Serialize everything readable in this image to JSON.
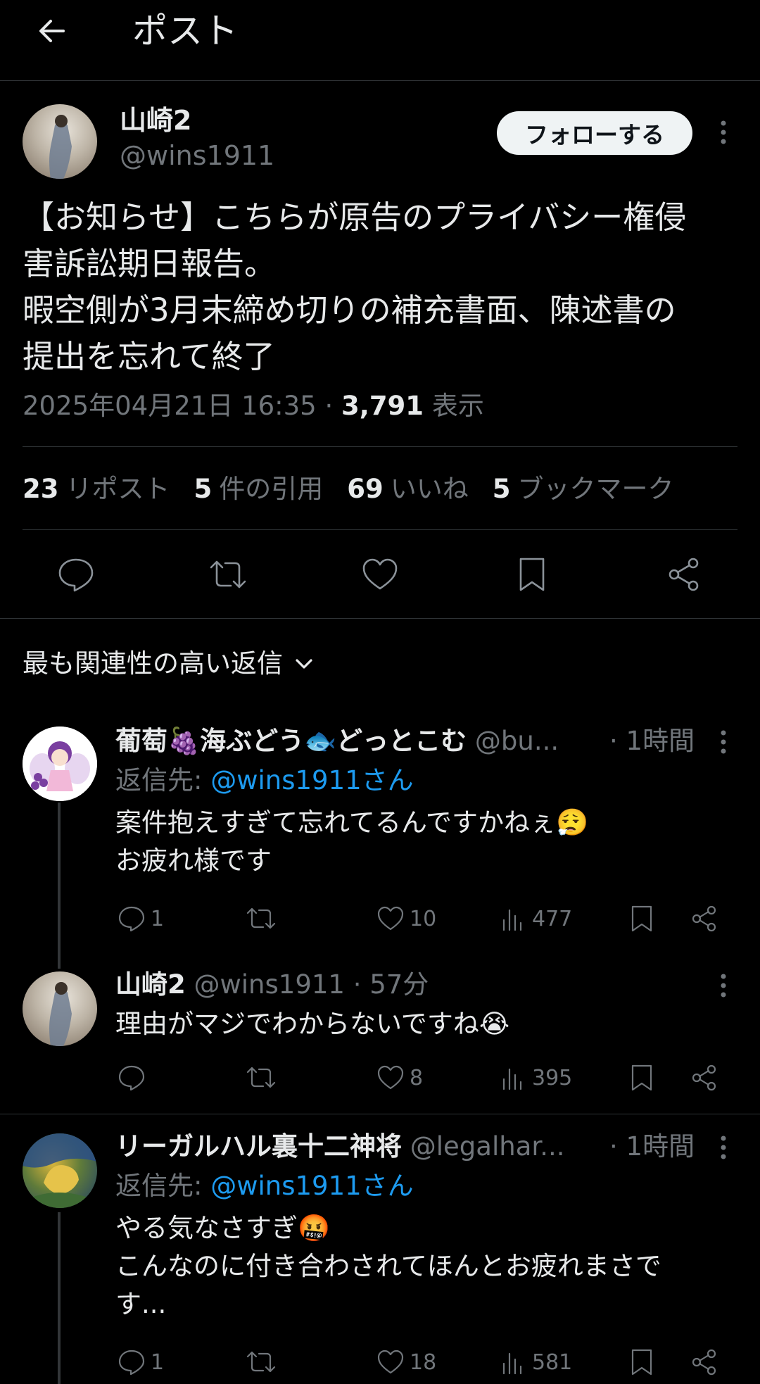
{
  "header": {
    "title": "ポスト"
  },
  "post": {
    "name": "山崎2",
    "handle": "@wins1911",
    "follow_label": "フォローする",
    "text": "【お知らせ】こちらが原告のプライバシー権侵\n害訴訟期日報告。\n暇空側が3月末締め切りの補充書面、陳述書の\n提出を忘れて終了",
    "timestamp": "2025年04月21日 16:35",
    "separator": "·",
    "views_count": "3,791",
    "views_label": "表示",
    "stats": [
      {
        "count": "23",
        "label": "リポスト"
      },
      {
        "count": "5",
        "label": "件の引用"
      },
      {
        "count": "69",
        "label": "いいね"
      },
      {
        "count": "5",
        "label": "ブックマーク"
      }
    ]
  },
  "sort": {
    "label": "最も関連性の高い返信"
  },
  "replies": [
    {
      "name": "葡萄🍇海ぶどう🐟どっとこむ",
      "handle": "@bu...",
      "time": "· 1時間",
      "reply_prefix": "返信先: ",
      "reply_to": "@wins1911さん",
      "text": "案件抱えすぎて忘れてるんですかねぇ😮‍💨\nお疲れ様です",
      "comments": "1",
      "likes": "10",
      "views": "477"
    },
    {
      "name": "山崎2",
      "handle": "@wins1911 · 57分",
      "text": "理由がマジでわからないですね😭",
      "comments": "",
      "likes": "8",
      "views": "395"
    },
    {
      "name": "リーガルハル裏十二神将",
      "handle": "@legalhar...",
      "time": "· 1時間",
      "reply_prefix": "返信先: ",
      "reply_to": "@wins1911さん",
      "text": "やる気なさすぎ🤬\nこんなのに付き合わされてほんとお疲れまさで\nす...",
      "comments": "1",
      "likes": "18",
      "views": "581"
    }
  ],
  "colors": {
    "background": "#000000",
    "text": "#e7e9ea",
    "muted": "#71767b",
    "link": "#1d9bf0",
    "divider": "#2f3336"
  }
}
